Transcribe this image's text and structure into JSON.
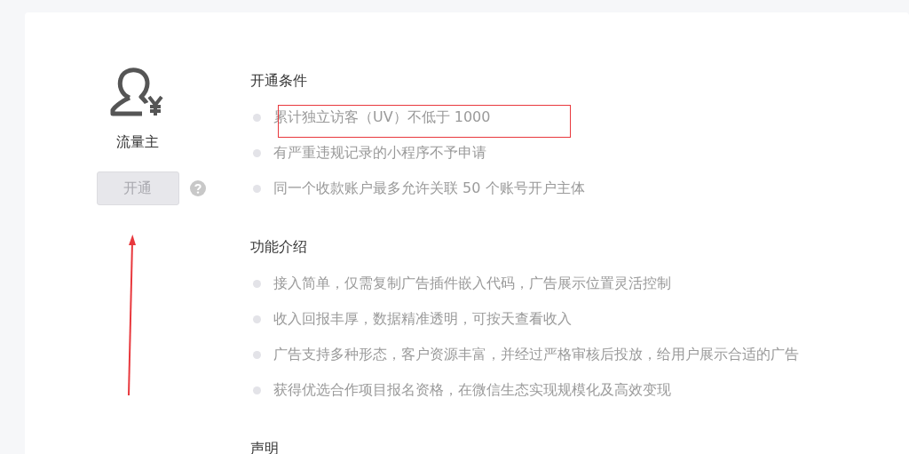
{
  "profile": {
    "label": "流量主",
    "button": {
      "label": "开通",
      "disabled": true
    }
  },
  "sections": [
    {
      "title": "开通条件",
      "items": [
        "累计独立访客（UV）不低于 1000",
        "有严重违规记录的小程序不予申请",
        "同一个收款账户最多允许关联 50 个账号开户主体"
      ]
    },
    {
      "title": "功能介绍",
      "items": [
        "接入简单，仅需复制广告插件嵌入代码，广告展示位置灵活控制",
        "收入回报丰厚，数据精准透明，可按天查看收入",
        "广告支持多种形态，客户资源丰富，并经过严格审核后投放，给用户展示合适的广告",
        "获得优选合作项目报名资格，在微信生态实现规模化及高效变现"
      ]
    },
    {
      "title": "声明"
    }
  ]
}
